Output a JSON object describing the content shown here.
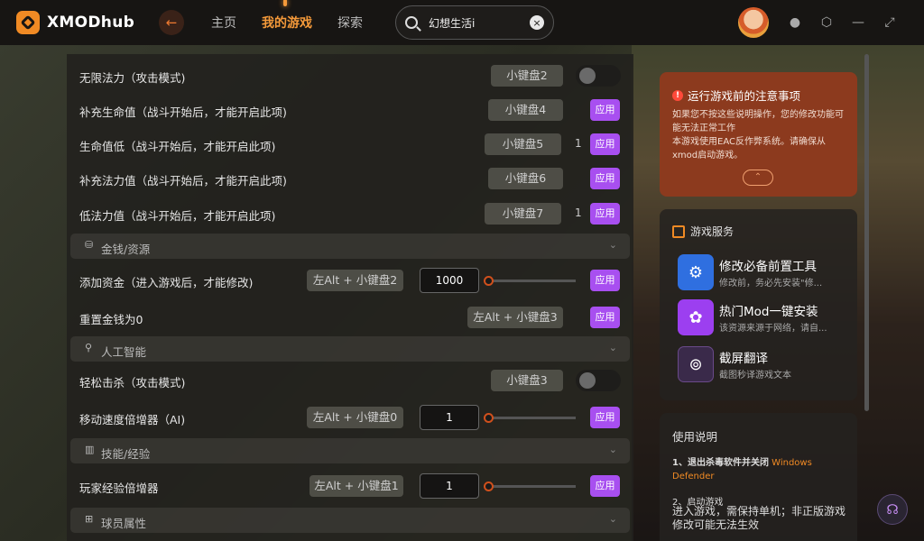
{
  "app": {
    "name": "XMODhub"
  },
  "nav": {
    "items": [
      "主页",
      "我的游戏",
      "探索"
    ],
    "active_index": 1
  },
  "search": {
    "value": "幻想生活i"
  },
  "colors": {
    "accent": "#f59a3a",
    "apply": "#a84ff0",
    "notice": "#8c3a1e"
  },
  "cheats": {
    "r1": {
      "label": "无限法力（攻击模式)",
      "key": "小键盘2"
    },
    "r2": {
      "label": "补充生命值（战斗开始后，才能开启此项)",
      "key": "小键盘4"
    },
    "r3": {
      "label": "生命值低（战斗开始后，才能开启此项)",
      "key": "小键盘5",
      "value": "1"
    },
    "r4": {
      "label": "补充法力值（战斗开始后，才能开启此项)",
      "key": "小键盘6"
    },
    "r5": {
      "label": "低法力值（战斗开始后，才能开启此项)",
      "key": "小键盘7",
      "value": "1"
    },
    "sec_money": "金钱/资源",
    "r6": {
      "label": "添加资金（进入游戏后，才能修改)",
      "key": "左Alt + 小键盘2",
      "input": "1000"
    },
    "r7": {
      "label": "重置金钱为0",
      "key": "左Alt + 小键盘3"
    },
    "sec_ai": "人工智能",
    "r8": {
      "label": "轻松击杀（攻击模式)",
      "key": "小键盘3"
    },
    "r9": {
      "label": "移动速度倍增器（AI)",
      "key": "左Alt + 小键盘0",
      "input": "1"
    },
    "sec_skill": "技能/经验",
    "r10": {
      "label": "玩家经验倍增器",
      "key": "左Alt + 小键盘1",
      "input": "1"
    },
    "sec_player": "球员属性",
    "apply_label": "应用"
  },
  "notice": {
    "title": "运行游戏前的注意事项",
    "text1": "如果您不按这些说明操作，您的修改功能可能无法正常工作",
    "text2": "本游戏使用EAC反作弊系统。请确保从xmod启动游戏。"
  },
  "services": {
    "title": "游戏服务",
    "items": [
      {
        "title": "修改必备前置工具",
        "desc": "修改前，务必先安装\"修...",
        "icon": "gear-icon"
      },
      {
        "title": "热门Mod一键安装",
        "desc": "该资源来源于网络，请自...",
        "icon": "flower-icon"
      },
      {
        "title": "截屏翻译",
        "desc": "截图秒译游戏文本",
        "icon": "download-icon"
      }
    ]
  },
  "guide": {
    "title": "使用说明",
    "s1_pre": "1、退出杀毒软件并关闭",
    "s1_hl": "Windows Defender",
    "s2": "2、启动游戏",
    "s3": "进入游戏，需保持单机；非正版游戏修改可能无法生效"
  }
}
